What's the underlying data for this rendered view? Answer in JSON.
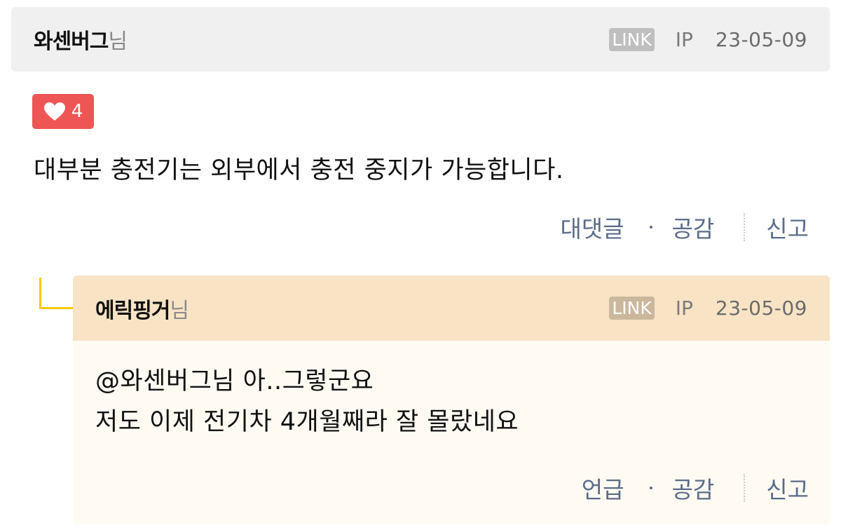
{
  "comment": {
    "author": "와센버그",
    "author_suffix": "님",
    "link_badge": "LINK",
    "ip_label": "IP",
    "date": "23-05-09",
    "like_count": "4",
    "body": "대부분 충전기는 외부에서 충전 중지가 가능합니다.",
    "actions": {
      "reply": "대댓글",
      "like": "공감",
      "report": "신고"
    }
  },
  "reply": {
    "author": "에릭핑거",
    "author_suffix": "님",
    "link_badge": "LINK",
    "ip_label": "IP",
    "date": "23-05-09",
    "body_line1": "@와센버그님 아..그렇군요",
    "body_line2": "저도 이제 전기차 4개월째라 잘 몰랐네요",
    "actions": {
      "mention": "언급",
      "like": "공감",
      "report": "신고"
    }
  },
  "colors": {
    "like_badge": "#ee5555",
    "reply_header": "#f8e4c5",
    "reply_background": "#fffbf3",
    "reply_connector": "#f5c800",
    "action_text": "#5a6b8a"
  },
  "icons": {
    "like": "heart-icon"
  }
}
